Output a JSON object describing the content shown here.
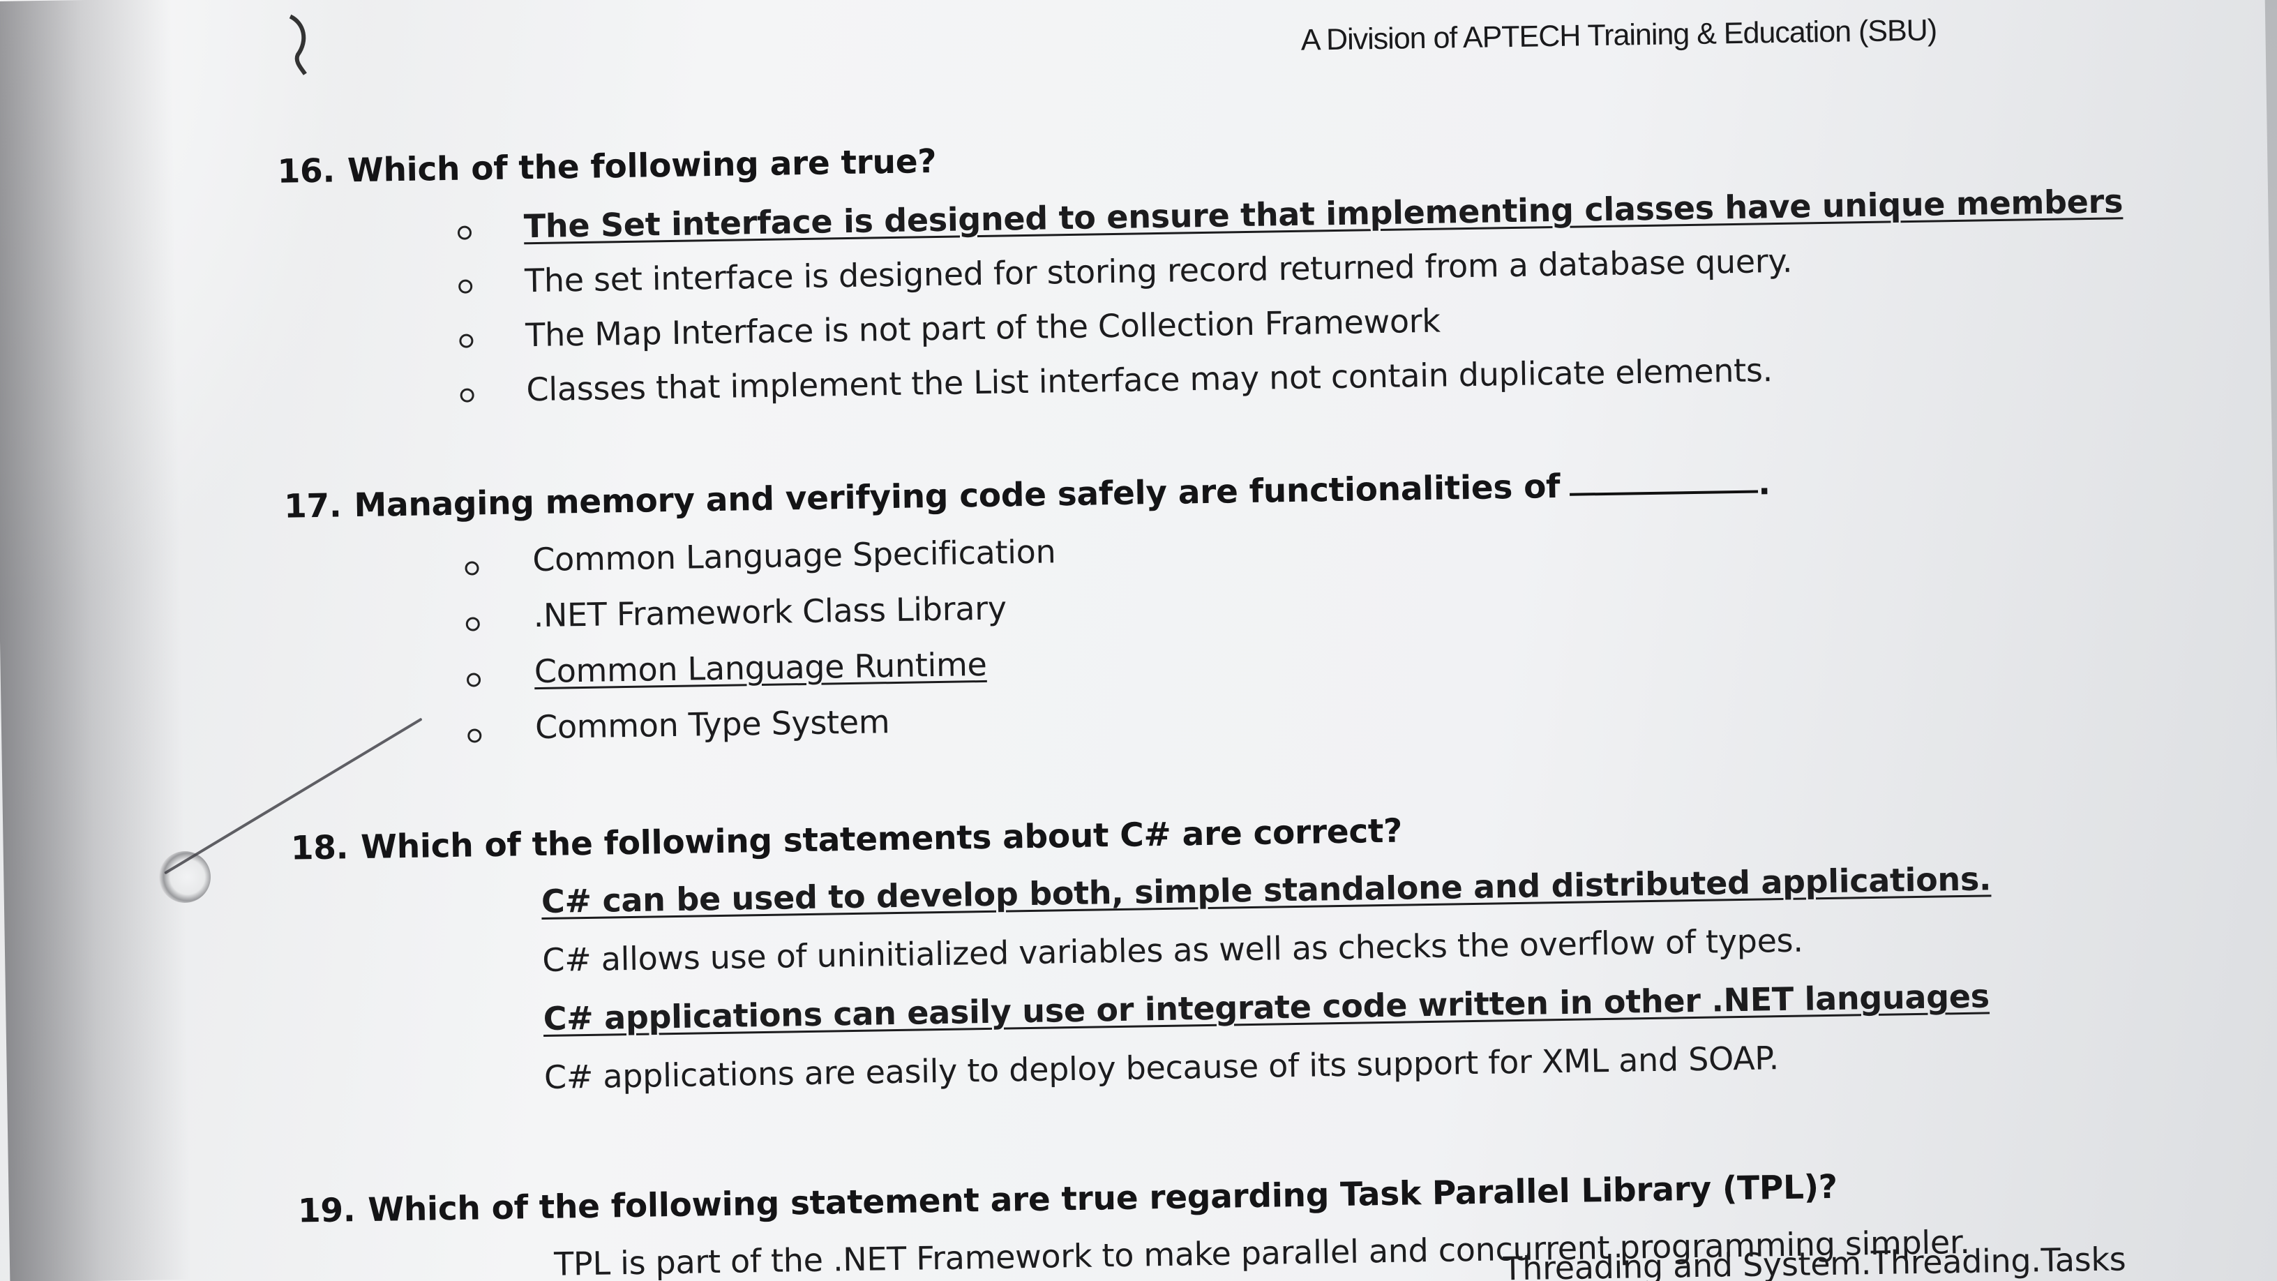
{
  "header": {
    "division_line": "A Division of APTECH Training & Education (SBU)"
  },
  "questions": [
    {
      "number": "16.",
      "text": "Which of the following are true?",
      "options": [
        "The Set interface is designed to ensure that implementing classes have unique members",
        "The set interface is designed for storing record returned from a database query.",
        "The Map Interface is not part of the Collection Framework",
        "Classes that implement the List interface may not contain duplicate elements."
      ]
    },
    {
      "number": "17.",
      "text": "Managing memory and verifying code safely are functionalities of",
      "blank_end": ".",
      "options": [
        "Common Language Specification",
        ".NET Framework Class Library",
        "Common Language Runtime",
        "Common Type System"
      ]
    },
    {
      "number": "18.",
      "text": "Which of the following statements about C# are correct?",
      "options": [
        "C# can be used to develop both, simple standalone and distributed applications.",
        "C# allows use of uninitialized variables as well as checks the overflow of types.",
        "C# applications can easily use or integrate code written in other .NET languages",
        "C# applications are easily to deploy because of its support for XML and SOAP."
      ]
    },
    {
      "number": "19.",
      "text": "Which of the following statement are true regarding Task Parallel Library (TPL)?",
      "options": [
        "TPL is part of the .NET Framework to make parallel and concurrent programming simpler.",
        "Threading and System.Threading.Tasks"
      ]
    }
  ]
}
